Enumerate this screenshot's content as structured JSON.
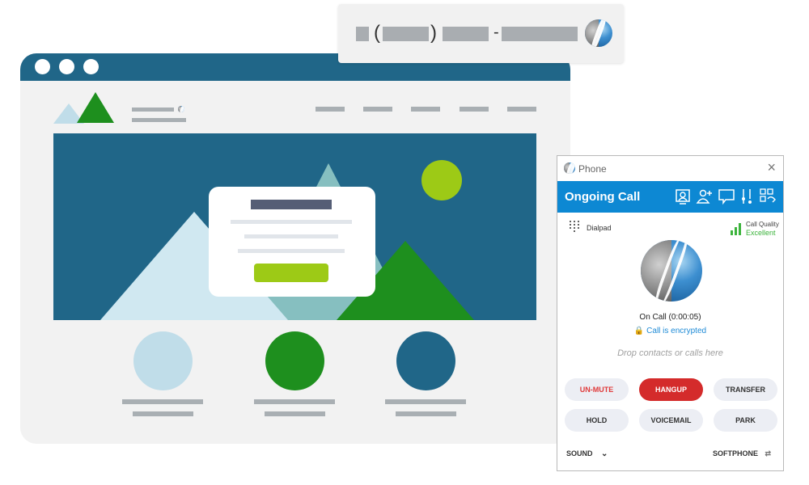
{
  "popup": {
    "open_paren": "(",
    "close_paren": ")",
    "dash": "-",
    "logo_icon": "brand-logo-icon"
  },
  "browser_mockup": {
    "colors": {
      "frame": "#206688",
      "page": "#f2f2f2",
      "hero": "#206688",
      "accent_green": "#1e8f1e",
      "lime": "#9dca16",
      "light_blue": "#c0dde9",
      "teal": "#86bfc0"
    },
    "nav_placeholder_count": 5,
    "feature_count": 3
  },
  "phone": {
    "window_title": "Phone",
    "close_icon": "×",
    "header_title": "Ongoing Call",
    "header_icons": [
      "contact-card-icon",
      "add-user-icon",
      "chat-icon",
      "sliders-icon",
      "apps-icon"
    ],
    "dialpad_label": "Dialpad",
    "call_quality_label": "Call Quality",
    "call_quality_value": "Excellent",
    "status": "On Call (0:00:05)",
    "encrypted_label": "Call is encrypted",
    "drop_hint": "Drop contacts or calls here",
    "buttons": [
      {
        "label": "UN-MUTE",
        "style": "red-text"
      },
      {
        "label": "HANGUP",
        "style": "hangup"
      },
      {
        "label": "TRANSFER",
        "style": "default"
      },
      {
        "label": "HOLD",
        "style": "default"
      },
      {
        "label": "VOICEMAIL",
        "style": "default"
      },
      {
        "label": "PARK",
        "style": "default"
      }
    ],
    "sound_label": "SOUND",
    "softphone_label": "SOFTPHONE",
    "colors": {
      "header": "#0d88d3",
      "hangup": "#d42b2b",
      "unmute_text": "#e03a3a",
      "quality": "#3bb33b",
      "encrypted": "#1d8ad6"
    }
  }
}
